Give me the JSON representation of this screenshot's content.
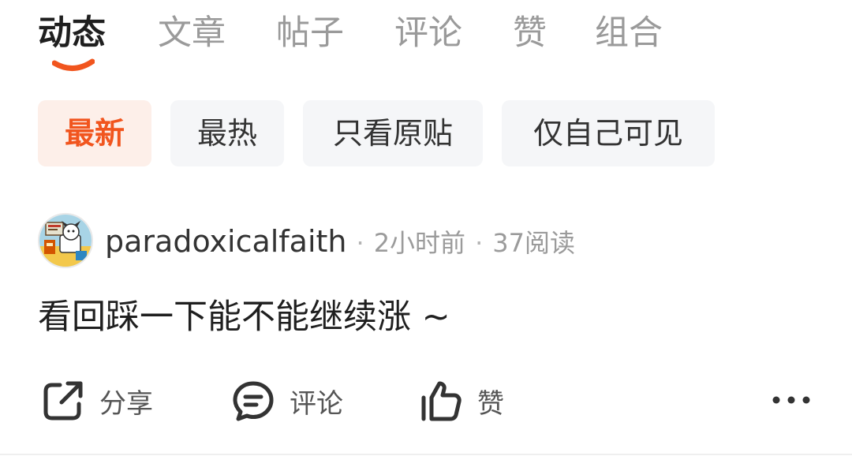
{
  "tabs": [
    {
      "label": "动态",
      "active": true
    },
    {
      "label": "文章",
      "active": false
    },
    {
      "label": "帖子",
      "active": false
    },
    {
      "label": "评论",
      "active": false
    },
    {
      "label": "赞",
      "active": false
    },
    {
      "label": "组合",
      "active": false
    }
  ],
  "filters": [
    {
      "label": "最新",
      "active": true
    },
    {
      "label": "最热",
      "active": false
    },
    {
      "label": "只看原贴",
      "active": false
    },
    {
      "label": "仅自己可见",
      "active": false
    }
  ],
  "post": {
    "username": "paradoxicalfaith",
    "time": "2小时前",
    "reads": "37阅读",
    "separator": "·",
    "content": "看回踩一下能不能继续涨 ~",
    "avatar_icon": "cartoon-dog-avatar-icon"
  },
  "actions": {
    "share_label": "分享",
    "comment_label": "评论",
    "like_label": "赞",
    "more_icon": "more-horizontal-icon"
  },
  "colors": {
    "accent": "#f1551e",
    "chip_active_bg": "#fdefe9",
    "chip_bg": "#f5f6f8",
    "text_primary": "#1f1f1f",
    "text_secondary": "#9b9b9b"
  }
}
